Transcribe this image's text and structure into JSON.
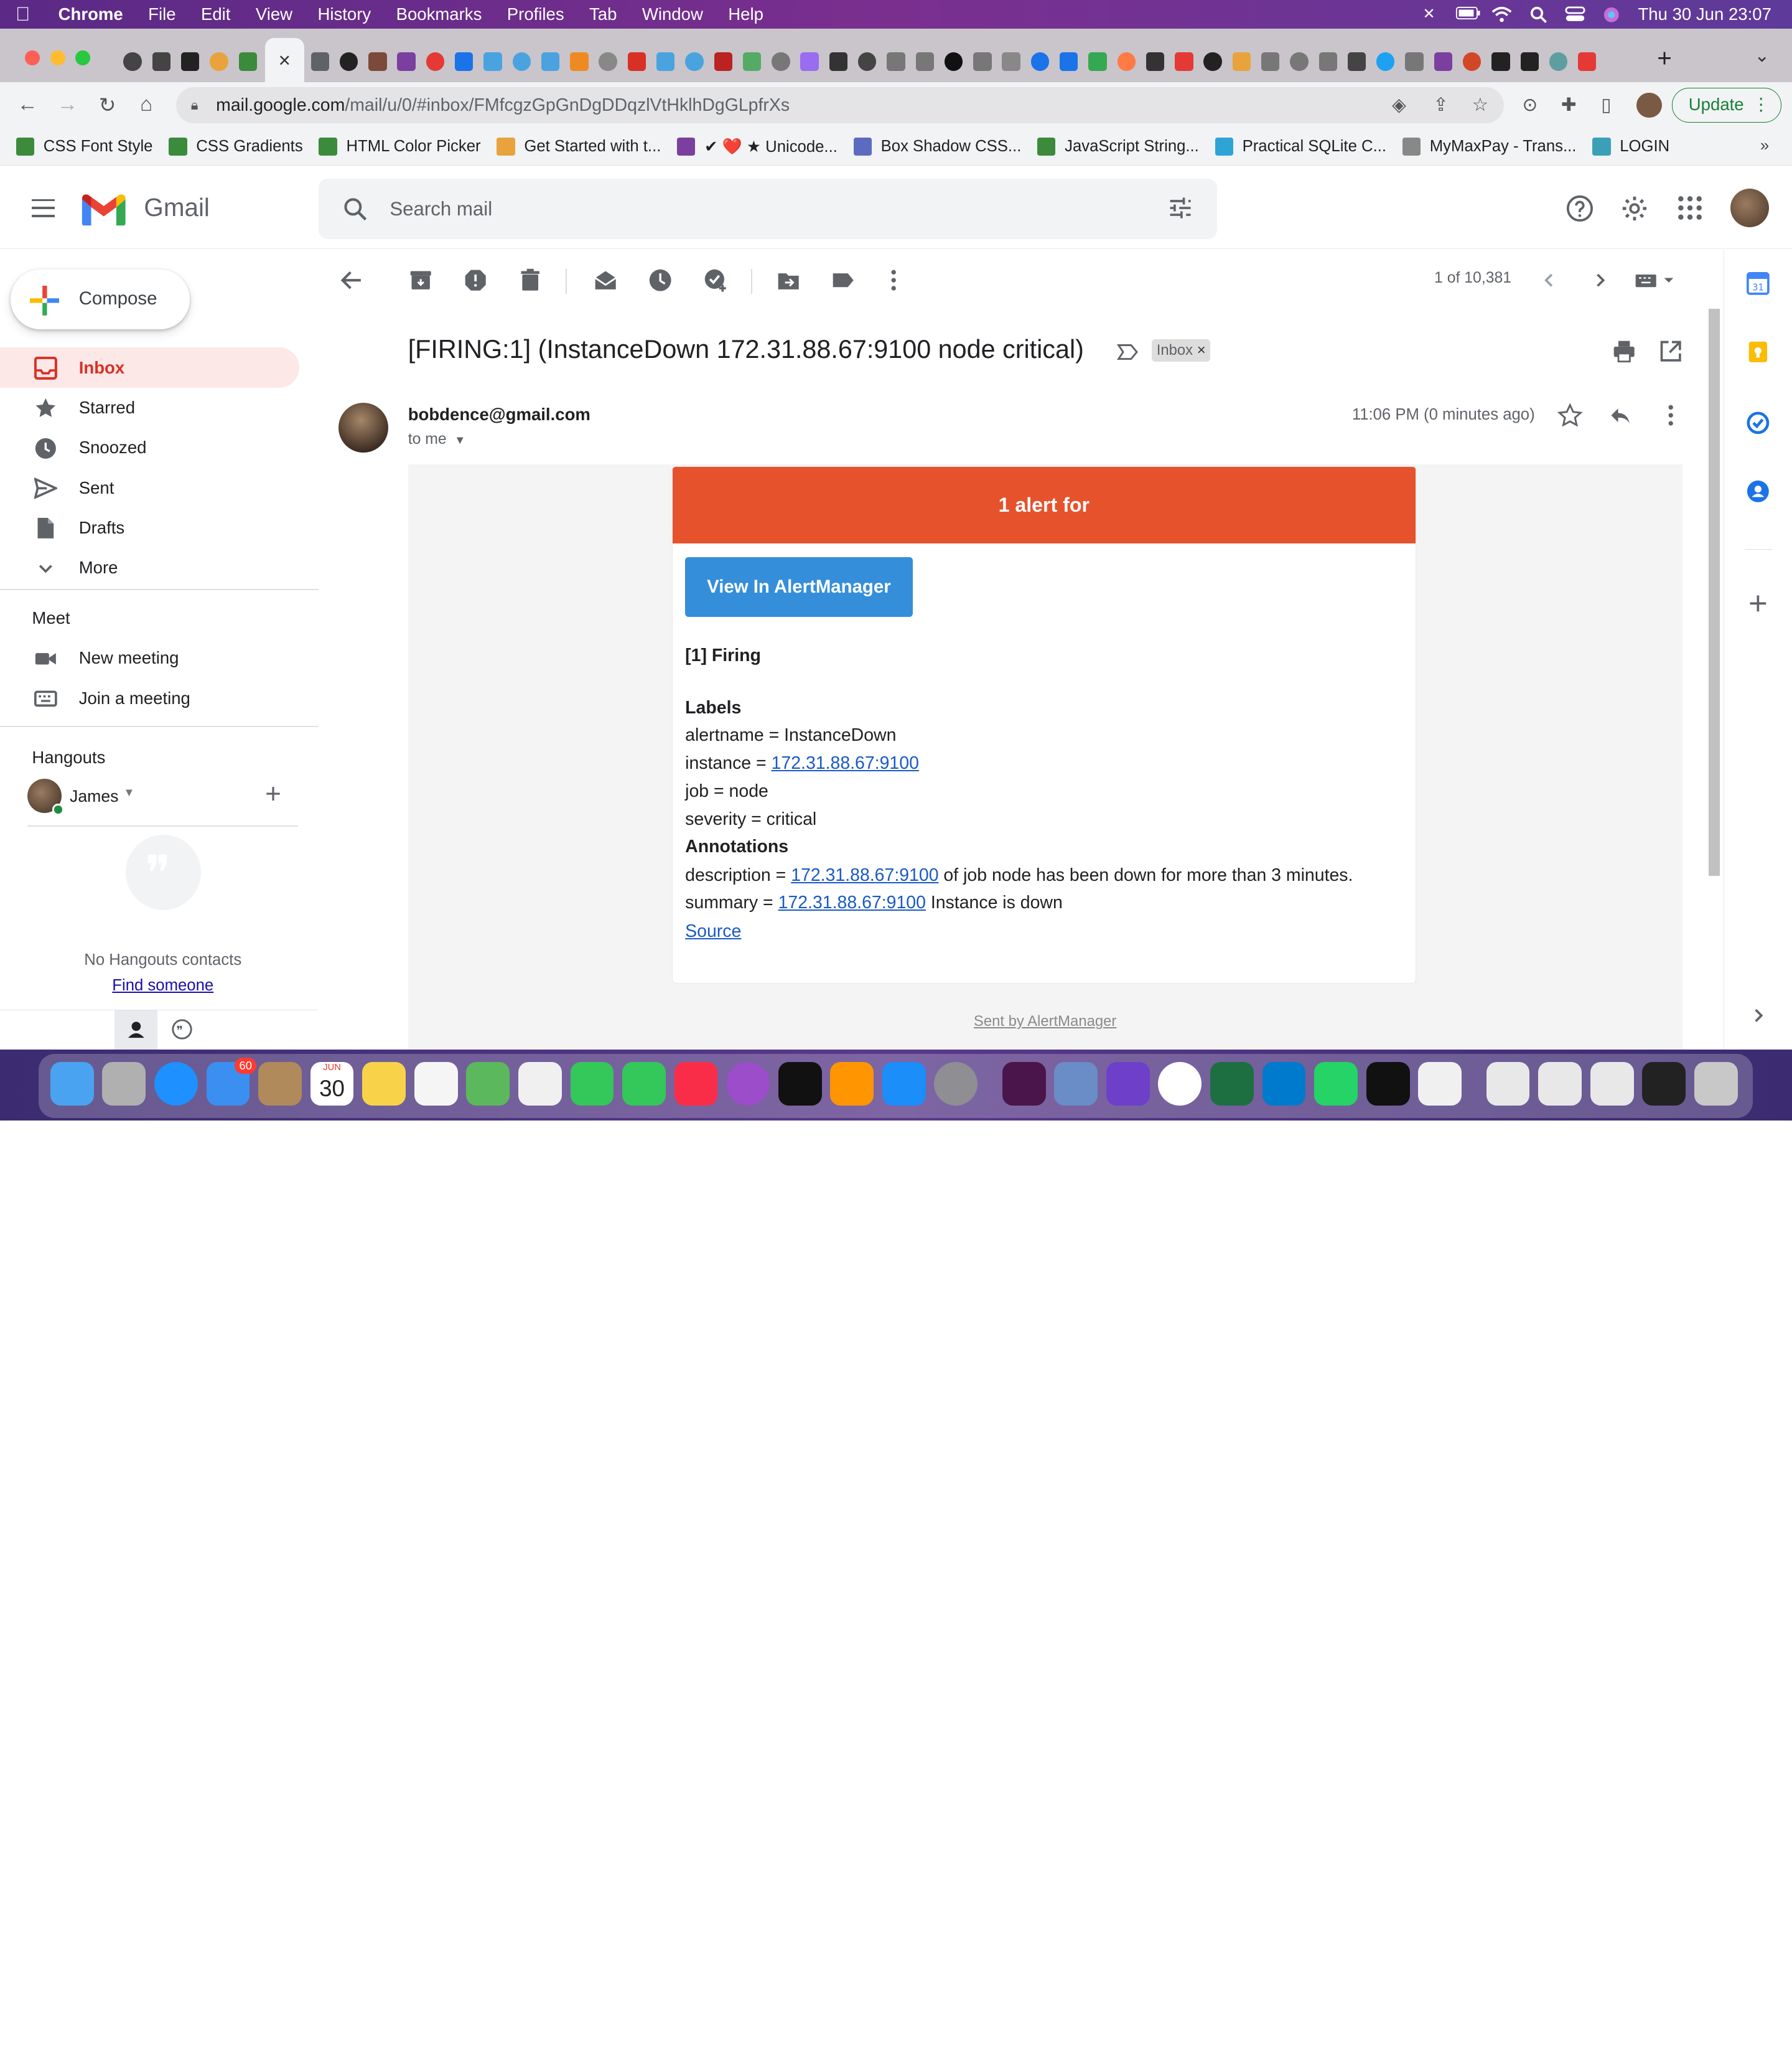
{
  "menubar": {
    "app": "Chrome",
    "items": [
      "File",
      "Edit",
      "View",
      "History",
      "Bookmarks",
      "Profiles",
      "Tab",
      "Window",
      "Help"
    ],
    "datetime": "Thu 30 Jun  23:07"
  },
  "browser": {
    "url_host": "mail.google.com",
    "url_path": "/mail/u/0/#inbox/FMfcgzGpGnDgDDqzlVtHklhDgGLpfrXs",
    "update_label": "Update"
  },
  "bookmarks": [
    {
      "label": "CSS Font Style",
      "color": "#3c8a3c"
    },
    {
      "label": "CSS Gradients",
      "color": "#3c8a3c"
    },
    {
      "label": "HTML Color Picker",
      "color": "#3c8a3c"
    },
    {
      "label": "Get Started with t...",
      "color": "#e8a33d"
    },
    {
      "label": "✔ ❤️ ★ Unicode...",
      "color": "#7b3fa0"
    },
    {
      "label": "Box Shadow CSS...",
      "color": "#5c6bc0"
    },
    {
      "label": "JavaScript String...",
      "color": "#3c8a3c"
    },
    {
      "label": "Practical SQLite C...",
      "color": "#2ea3d6"
    },
    {
      "label": "MyMaxPay - Trans...",
      "color": "#888888"
    },
    {
      "label": "LOGIN",
      "color": "#3aa0b8"
    }
  ],
  "gmail": {
    "logo_text": "Gmail",
    "search_placeholder": "Search mail",
    "compose": "Compose",
    "nav": [
      "Inbox",
      "Starred",
      "Snoozed",
      "Sent",
      "Drafts",
      "More"
    ],
    "meet_title": "Meet",
    "meet_items": [
      "New meeting",
      "Join a meeting"
    ],
    "hangouts_title": "Hangouts",
    "hangouts_user": "James",
    "no_contacts": "No Hangouts contacts",
    "find_someone": "Find someone"
  },
  "message": {
    "pager": "1 of 10,381",
    "subject": "[FIRING:1] (InstanceDown 172.31.88.67:9100 node critical)",
    "label_chip": "Inbox",
    "sender": "bobdence@gmail.com",
    "to": "to me",
    "time": "11:06 PM (0 minutes ago)"
  },
  "alert": {
    "header": "1 alert for",
    "button": "View In AlertManager",
    "firing": "[1] Firing",
    "labels_title": "Labels",
    "alertname": "alertname = InstanceDown",
    "instance_prefix": "instance = ",
    "instance_link": "172.31.88.67:9100",
    "job": "job = node",
    "severity": "severity = critical",
    "annotations_title": "Annotations",
    "desc_prefix": "description = ",
    "desc_link": "172.31.88.67:9100",
    "desc_suffix": " of job node has been down for more than 3 minutes.",
    "summary_prefix": "summary = ",
    "summary_link": "172.31.88.67:9100",
    "summary_suffix": " Instance is down",
    "source": "Source",
    "sent_by": "Sent by AlertManager"
  },
  "dock": {
    "mail_badge": "60",
    "calendar_month": "JUN",
    "calendar_day": "30"
  },
  "colors": {
    "alert_header": "#e6522c",
    "alert_button": "#348eda",
    "inbox_active_bg": "#fce8e6",
    "inbox_active_text": "#d93025"
  }
}
